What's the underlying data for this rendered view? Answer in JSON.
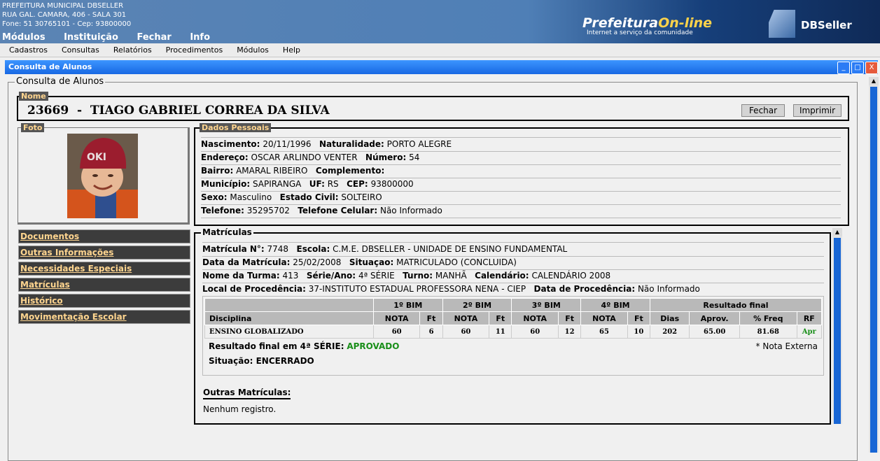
{
  "header": {
    "inst_line1": "PREFEITURA MUNICIPAL DBSELLER",
    "inst_line2": "RUA GAL. CAMARA, 406 - SALA 301",
    "inst_line3": "Fone: 51 30765101  -  Cep: 93800000",
    "menu": [
      "Módulos",
      "Instituição",
      "Fechar",
      "Info"
    ],
    "brand1_a": "Prefeitura",
    "brand1_b": "On-line",
    "brand1_sub": "Internet a serviço da comunidade",
    "brand2": "DBSeller"
  },
  "menubar": [
    "Cadastros",
    "Consultas",
    "Relatórios",
    "Procedimentos",
    "Módulos",
    "Help"
  ],
  "window": {
    "title": "Consulta de Alunos",
    "fieldset_legend": "Consulta de Alunos",
    "min": "_",
    "max": "□",
    "close": "X"
  },
  "nome": {
    "legend": "Nome",
    "value": "23669  -  TIAGO GABRIEL CORREA DA SILVA",
    "fechar": "Fechar",
    "imprimir": "Imprimir"
  },
  "foto": {
    "legend": "Foto"
  },
  "dados": {
    "legend": "Dados Pessoais",
    "nascimento_l": "Nascimento:",
    "nascimento": "20/11/1996",
    "naturalidade_l": "Naturalidade:",
    "naturalidade": "PORTO ALEGRE",
    "endereco_l": "Endereço:",
    "endereco": "OSCAR ARLINDO VENTER",
    "numero_l": "Número:",
    "numero": "54",
    "bairro_l": "Bairro:",
    "bairro": "AMARAL RIBEIRO",
    "complemento_l": "Complemento:",
    "municipio_l": "Município:",
    "municipio": "SAPIRANGA",
    "uf_l": "UF:",
    "uf": "RS",
    "cep_l": "CEP:",
    "cep": "93800000",
    "sexo_l": "Sexo:",
    "sexo": "Masculino",
    "civil_l": "Estado Civil:",
    "civil": "SOLTEIRO",
    "tel_l": "Telefone:",
    "tel": "35295702",
    "cel_l": "Telefone Celular:",
    "cel": "Não Informado"
  },
  "leftmenu": [
    "Documentos",
    "Outras Informações",
    "Necessidades Especiais",
    "Matrículas",
    "Histórico",
    "Movimentação Escolar"
  ],
  "matriculas": {
    "legend": "Matrículas",
    "matricula_l": "Matrícula N°:",
    "matricula": "7748",
    "escola_l": "Escola:",
    "escola": "C.M.E. DBSELLER - UNIDADE DE ENSINO FUNDAMENTAL",
    "data_l": "Data da Matrícula:",
    "data": "25/02/2008",
    "situacao_l": "Situaçao:",
    "situacao": "MATRICULADO (CONCLUIDA)",
    "turma_l": "Nome da Turma:",
    "turma": "413",
    "serie_l": "Série/Ano:",
    "serie": "4ª SÉRIE",
    "turno_l": "Turno:",
    "turno": "MANHÃ",
    "cal_l": "Calendário:",
    "cal": "CALENDÁRIO 2008",
    "local_l": "Local de Procedência:",
    "local": "37-INSTITUTO ESTADUAL PROFESSORA NENA - CIEP",
    "dataproc_l": "Data de Procedência:",
    "dataproc": "Não Informado",
    "table": {
      "bims": [
        "1º BIM",
        "2º BIM",
        "3º BIM",
        "4º BIM"
      ],
      "resultado": "Resultado final",
      "disciplina": "Disciplina",
      "nota": "NOTA",
      "ft": "Ft",
      "dias": "Dias",
      "aprov": "Aprov.",
      "freq": "% Freq",
      "rf": "RF",
      "row": {
        "name": "ENSINO GLOBALIZADO",
        "cells": [
          "60",
          "6",
          "60",
          "11",
          "60",
          "12",
          "65",
          "10",
          "202",
          "65.00",
          "81.68"
        ],
        "rf": "Apr"
      }
    },
    "resultado_l": "Resultado final em 4ª SÉRIE:",
    "resultado_v": "APROVADO",
    "nota_externa": "* Nota Externa",
    "situacao2_l": "Situação:",
    "situacao2": "ENCERRADO",
    "outras_title": "Outras Matrículas:",
    "outras_v": "Nenhum registro."
  },
  "colors": {
    "titlebar": "#1768e3",
    "aprovado": "#1a8f1a",
    "legend_bg": "#555555",
    "legend_text": "#ffd58f"
  }
}
